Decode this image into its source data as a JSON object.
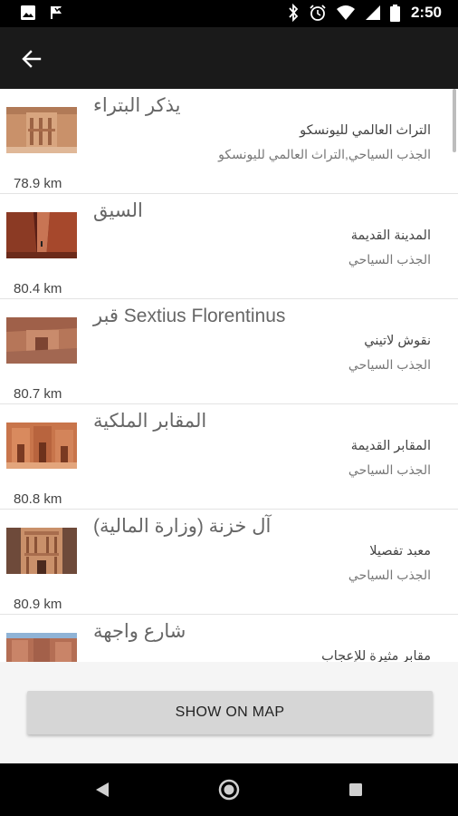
{
  "status_bar": {
    "time": "2:50"
  },
  "places": [
    {
      "title": "يذكر البتراء",
      "subtitle": "التراث العالمي لليونسكو",
      "category": "الجذب السياحي,التراث العالمي لليونسكو",
      "distance": "78.9 km"
    },
    {
      "title": "السيق",
      "subtitle": "المدينة القديمة",
      "category": "الجذب السياحي",
      "distance": "80.4 km"
    },
    {
      "title": "قبر Sextius Florentinus",
      "subtitle": "نقوش لاتيني",
      "category": "الجذب السياحي",
      "distance": "80.7 km"
    },
    {
      "title": "المقابر الملكية",
      "subtitle": "المقابر القديمة",
      "category": "الجذب السياحي",
      "distance": "80.8 km"
    },
    {
      "title": "آل خزنة (وزارة المالية)",
      "subtitle": "معبد تفصيلا",
      "category": "الجذب السياحي",
      "distance": "80.9 km"
    },
    {
      "title": "شارع واجهة",
      "subtitle": "مقابر مثيرة للإعجاب",
      "category": "",
      "distance": ""
    }
  ],
  "actions": {
    "show_on_map": "SHOW ON MAP"
  }
}
